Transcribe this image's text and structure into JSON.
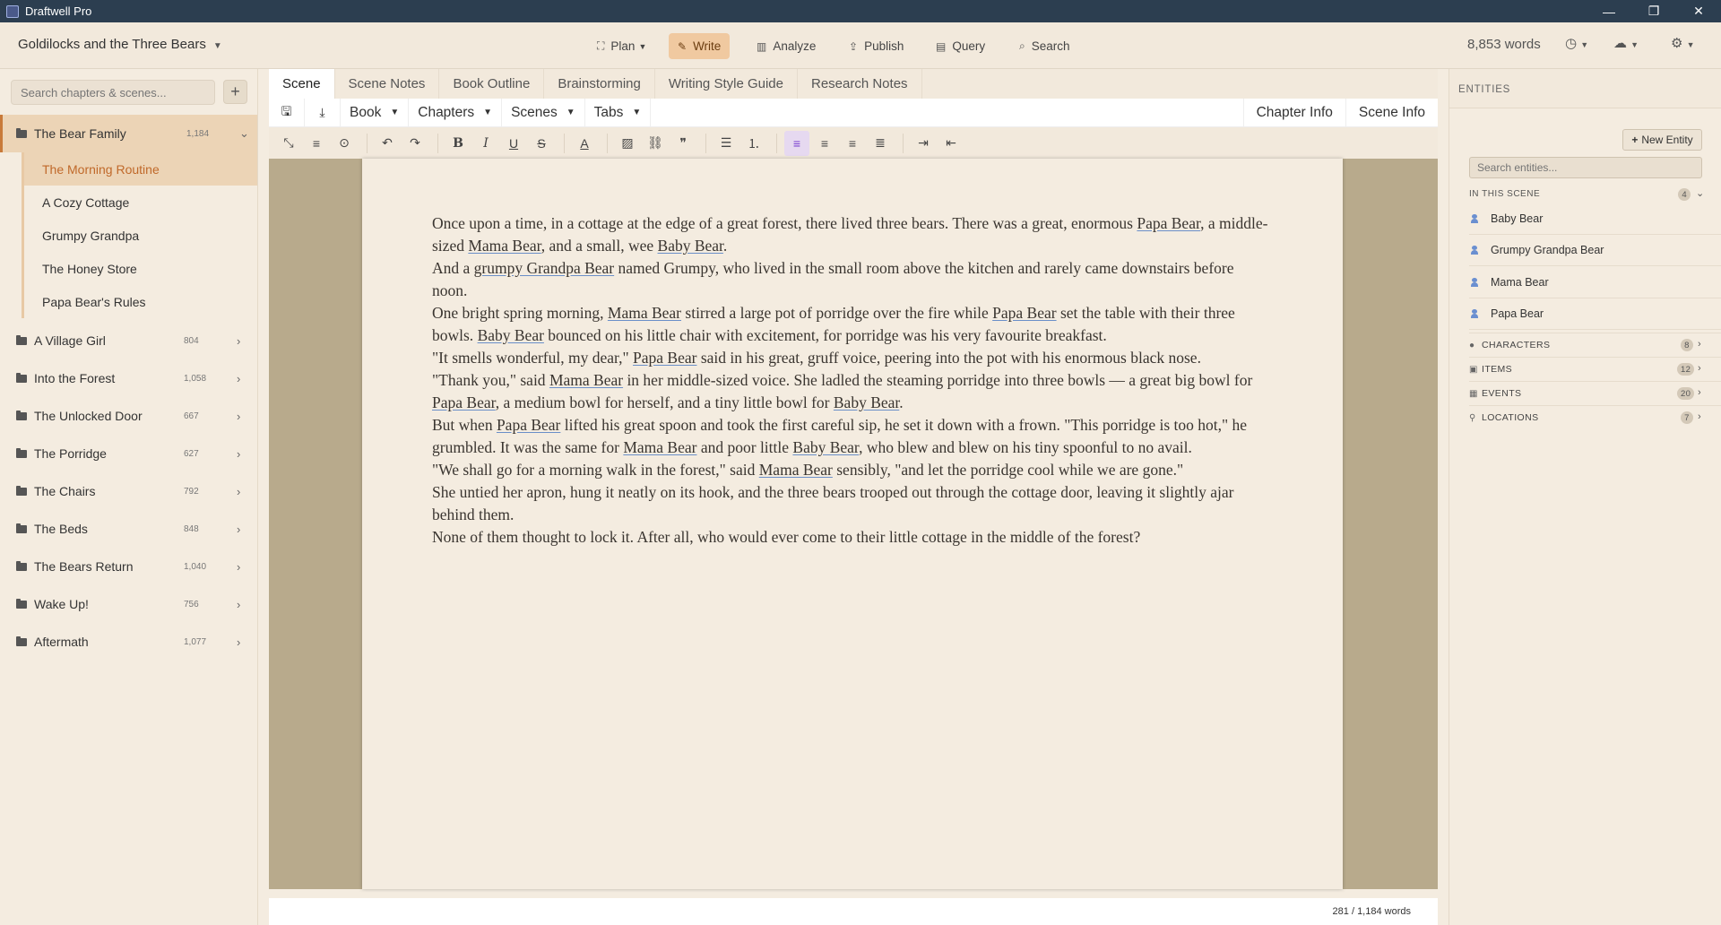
{
  "window": {
    "title": "Draftwell Pro",
    "minimize": "—",
    "maximize": "❐",
    "close": "✕"
  },
  "menubar": {
    "doc_title": "Goldilocks and the Three Bears",
    "nav": [
      {
        "label": "Plan",
        "icon": "plan-icon"
      },
      {
        "label": "Write",
        "icon": "pencil-icon"
      },
      {
        "label": "Analyze",
        "icon": "chart-icon"
      },
      {
        "label": "Publish",
        "icon": "upload-icon"
      },
      {
        "label": "Query",
        "icon": "table-icon"
      },
      {
        "label": "Search",
        "icon": "search-icon"
      }
    ],
    "word_count": "8,853 words"
  },
  "sidebar": {
    "search_placeholder": "Search chapters & scenes...",
    "chapters": [
      {
        "title": "The Bear Family",
        "count": "1,184",
        "expanded": true,
        "scenes": [
          "The Morning Routine",
          "A Cozy Cottage",
          "Grumpy Grandpa",
          "The Honey Store",
          "Papa Bear's Rules"
        ]
      },
      {
        "title": "A Village Girl",
        "count": "804"
      },
      {
        "title": "Into the Forest",
        "count": "1,058"
      },
      {
        "title": "The Unlocked Door",
        "count": "667"
      },
      {
        "title": "The Porridge",
        "count": "627"
      },
      {
        "title": "The Chairs",
        "count": "792"
      },
      {
        "title": "The Beds",
        "count": "848"
      },
      {
        "title": "The Bears Return",
        "count": "1,040"
      },
      {
        "title": "Wake Up!",
        "count": "756"
      },
      {
        "title": "Aftermath",
        "count": "1,077"
      }
    ]
  },
  "editor": {
    "tabs": [
      "Scene",
      "Scene Notes",
      "Book Outline",
      "Brainstorming",
      "Writing Style Guide",
      "Research Notes"
    ],
    "toolbar": {
      "book": "Book",
      "chapters": "Chapters",
      "scenes": "Scenes",
      "tabs": "Tabs",
      "chapter_info": "Chapter Info",
      "scene_info": "Scene Info"
    },
    "status": "281 / 1,184 words"
  },
  "document": {
    "paragraphs": [
      [
        [
          "Once upon a time, in a cottage at the edge of a great forest, there lived three bears. There was a great, enormous ",
          false
        ],
        [
          "Papa Bear",
          true
        ],
        [
          ", a middle-sized ",
          false
        ],
        [
          "Mama Bear",
          true
        ],
        [
          ", and a small, wee ",
          false
        ],
        [
          "Baby Bear",
          true
        ],
        [
          ".",
          false
        ]
      ],
      [
        [
          "And a ",
          false
        ],
        [
          "grumpy Grandpa Bear",
          true
        ],
        [
          " named Grumpy, who lived in the small room above the kitchen and rarely came downstairs before noon.",
          false
        ]
      ],
      [
        [
          "One bright spring morning, ",
          false
        ],
        [
          "Mama Bear",
          true
        ],
        [
          " stirred a large pot of porridge over the fire while ",
          false
        ],
        [
          "Papa Bear",
          true
        ],
        [
          " set the table with their three bowls. ",
          false
        ],
        [
          "Baby Bear",
          true
        ],
        [
          " bounced on his little chair with excitement, for porridge was his very favourite breakfast.",
          false
        ]
      ],
      [
        [
          "\"It smells wonderful, my dear,\" ",
          false
        ],
        [
          "Papa Bear",
          true
        ],
        [
          " said in his great, gruff voice, peering into the pot with his enormous black nose.",
          false
        ]
      ],
      [
        [
          "\"Thank you,\" said ",
          false
        ],
        [
          "Mama Bear",
          true
        ],
        [
          " in her middle-sized voice. She ladled the steaming porridge into three bowls — a great big bowl for ",
          false
        ],
        [
          "Papa Bear",
          true
        ],
        [
          ", a medium bowl for herself, and a tiny little bowl for ",
          false
        ],
        [
          "Baby Bear",
          true
        ],
        [
          ".",
          false
        ]
      ],
      [
        [
          "But when ",
          false
        ],
        [
          "Papa Bear",
          true
        ],
        [
          " lifted his great spoon and took the first careful sip, he set it down with a frown. \"This porridge is too hot,\" he grumbled. It was the same for ",
          false
        ],
        [
          "Mama Bear",
          true
        ],
        [
          " and poor little ",
          false
        ],
        [
          "Baby Bear",
          true
        ],
        [
          ", who blew and blew on his tiny spoonful to no avail.",
          false
        ]
      ],
      [
        [
          "\"We shall go for a morning walk in the forest,\" said ",
          false
        ],
        [
          "Mama Bear",
          true
        ],
        [
          " sensibly, \"and let the porridge cool while we are gone.\"",
          false
        ]
      ],
      [
        [
          "She untied her apron, hung it neatly on its hook, and the three bears trooped out through the cottage door, leaving it slightly ajar behind them.",
          false
        ]
      ],
      [
        [
          "None of them thought to lock it. After all, who would ever come to their little cottage in the middle of the forest?",
          false
        ]
      ]
    ]
  },
  "entities": {
    "header": "ENTITIES",
    "new_button": "New Entity",
    "search_placeholder": "Search entities...",
    "in_scene_label": "IN THIS SCENE",
    "in_scene_count": "4",
    "in_scene": [
      "Baby Bear",
      "Grumpy Grandpa Bear",
      "Mama Bear",
      "Papa Bear"
    ],
    "categories": [
      {
        "label": "CHARACTERS",
        "count": "8",
        "icon": "person-icon"
      },
      {
        "label": "ITEMS",
        "count": "12",
        "icon": "box-icon"
      },
      {
        "label": "EVENTS",
        "count": "20",
        "icon": "calendar-icon"
      },
      {
        "label": "LOCATIONS",
        "count": "7",
        "icon": "pin-icon"
      }
    ]
  }
}
